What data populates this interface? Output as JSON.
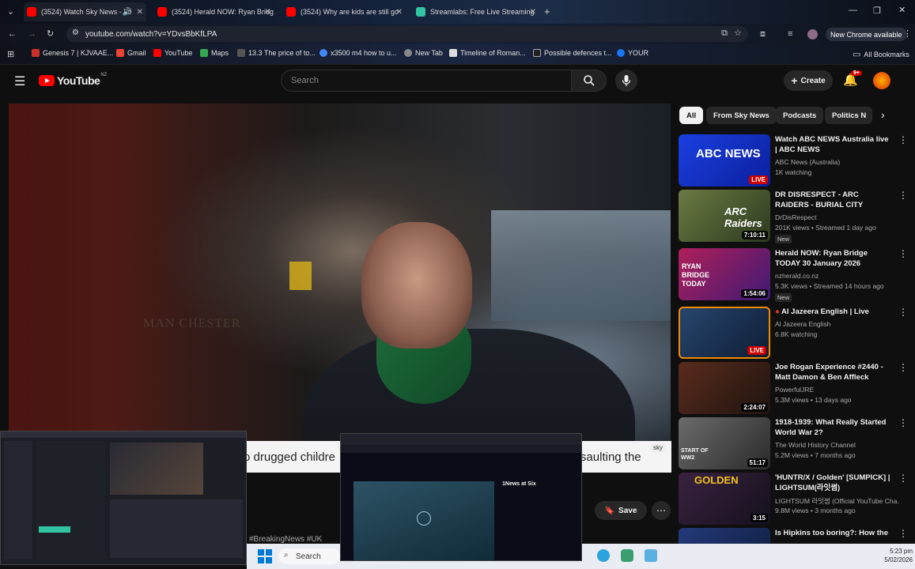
{
  "browser": {
    "tabs": [
      {
        "label": "(3524) Watch Sky News - Yo",
        "active": true
      },
      {
        "label": "(3524) Herald NOW: Ryan Bridg",
        "active": false
      },
      {
        "label": "(3524) Why are kids are still go",
        "active": false
      },
      {
        "label": "Streamlabs: Free Live Streaming",
        "active": false
      }
    ],
    "url": "youtube.com/watch?v=YDvsBbKfLPA",
    "new_chrome": "New Chrome available",
    "bookmarks": [
      {
        "label": "Genesis 7 | KJVAAE...",
        "color": "#c9302c"
      },
      {
        "label": "Gmail",
        "color": "#ea4335"
      },
      {
        "label": "YouTube",
        "color": "#ff0000"
      },
      {
        "label": "Maps",
        "color": "#34a853"
      },
      {
        "label": "13.3 The price of to...",
        "color": "#555555"
      },
      {
        "label": "x3500 m4 how to u...",
        "color": "#4285f4"
      },
      {
        "label": "New Tab",
        "color": "#888888"
      },
      {
        "label": "Timeline of Roman...",
        "color": "#dddddd"
      },
      {
        "label": "Possible defences t...",
        "color": "#222222"
      },
      {
        "label": "YOUR",
        "color": "#1877f2"
      }
    ],
    "all_bookmarks": "All Bookmarks"
  },
  "youtube": {
    "logo": "YouTube",
    "region": "NZ",
    "search_placeholder": "Search",
    "create_label": "Create",
    "notif_count": "9+"
  },
  "video": {
    "sign_text": "MAN CHESTER",
    "ticker_text": "o drugged childre",
    "ticker_text2": "saulting the",
    "ticker_badge": "sky"
  },
  "chips": [
    "All",
    "From Sky News",
    "Podcasts",
    "Politics N"
  ],
  "recommendations": [
    {
      "title": "Watch ABC NEWS Australia live | ABC NEWS",
      "channel": "ABC News (Australia)",
      "meta": "1K watching",
      "badge": "LIVE",
      "thumb_text": "ABC NEWS",
      "new": ""
    },
    {
      "title": "DR DISRESPECT - ARC RAIDERS - BURIAL CITY KILLAS",
      "channel": "DrDisRespect",
      "meta": "201K views • Streamed 1 day ago",
      "badge": "7:10:11",
      "thumb_text": "ARC Raiders",
      "new": "New"
    },
    {
      "title": "Herald NOW: Ryan Bridge TODAY 30 January 2026",
      "channel": "nzherald.co.nz",
      "meta": "5.3K views • Streamed 14 hours ago",
      "badge": "1:54:06",
      "thumb_text": "RYAN BRIDGE TODAY",
      "new": "New"
    },
    {
      "title": "Al Jazeera English | Live",
      "channel": "Al Jazeera English",
      "meta": "6.8K watching",
      "badge": "LIVE",
      "thumb_text": "LIVE",
      "new": ""
    },
    {
      "title": "Joe Rogan Experience #2440 - Matt Damon & Ben Affleck",
      "channel": "PowerfulJRE",
      "meta": "5.3M views • 13 days ago",
      "badge": "2:24:07",
      "thumb_text": "",
      "new": ""
    },
    {
      "title": "1918-1939: What Really Started World War 2?",
      "channel": "The World History Channel",
      "meta": "5.2M views • 7 months ago",
      "badge": "51:17",
      "thumb_text": "START OF WW2",
      "new": ""
    },
    {
      "title": "'HUNTR/X / Golden' [SUMPICK] | LIGHTSUM(라잇썸)",
      "channel": "LIGHTSUM 라잇썸 (Official YouTube Cha...",
      "meta": "9.8M views • 3 months ago",
      "badge": "3:15",
      "thumb_text": "GOLDEN",
      "new": ""
    },
    {
      "title": "Is Hipkins too boring?: How the",
      "channel": "",
      "meta": "",
      "badge": "",
      "thumb_text": "",
      "new": ""
    }
  ],
  "actions": {
    "save_label": "Save"
  },
  "hashtags": "#BreakingNews #UK",
  "iplayer": {
    "title": "1News at Six"
  },
  "taskbar": {
    "search": "Search",
    "time": "5:23 pm",
    "date": "5/02/2026"
  }
}
